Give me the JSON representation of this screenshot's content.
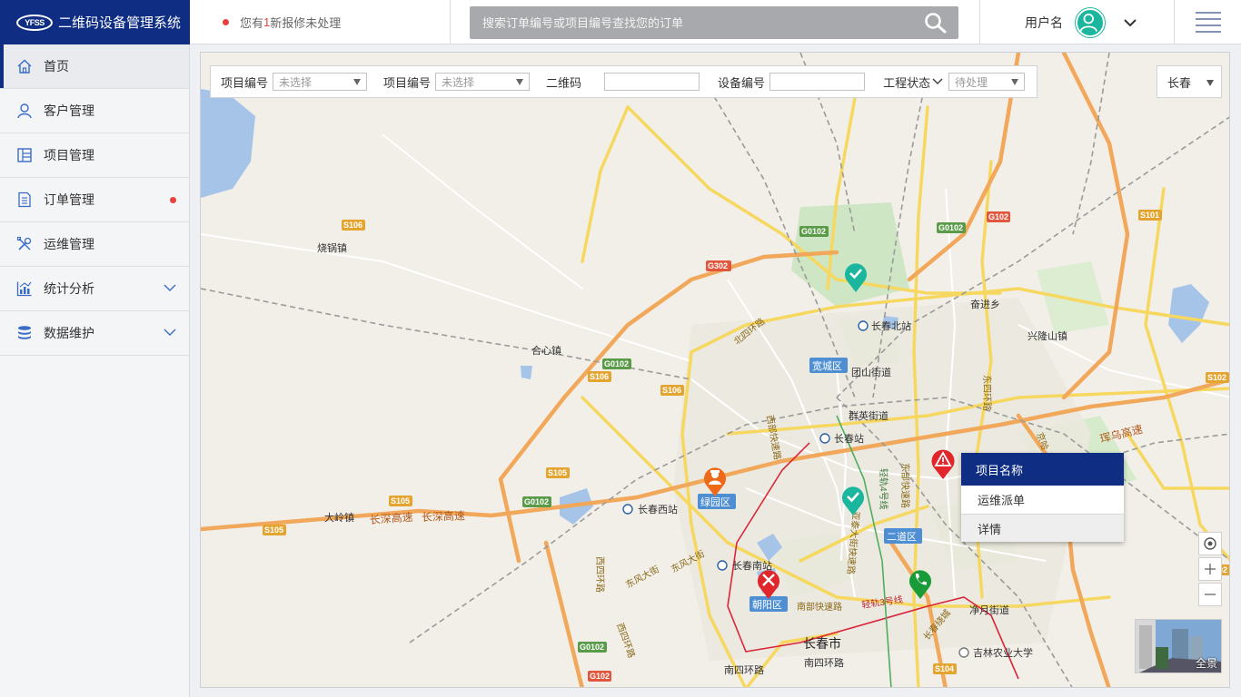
{
  "header": {
    "logo_text": "YFSS",
    "title": "二维码设备管理系统",
    "notice_prefix": "您有",
    "notice_count": "1",
    "notice_suffix": "新报修未处理",
    "search_placeholder": "搜索订单编号或项目编号查找您的订单",
    "username": "用户名"
  },
  "sidebar": {
    "items": [
      {
        "label": "首页",
        "icon": "home-icon",
        "active": true
      },
      {
        "label": "客户管理",
        "icon": "user-icon"
      },
      {
        "label": "项目管理",
        "icon": "project-icon"
      },
      {
        "label": "订单管理",
        "icon": "order-icon",
        "badge": true
      },
      {
        "label": "运维管理",
        "icon": "tools-icon"
      },
      {
        "label": "统计分析",
        "icon": "chart-icon",
        "expandable": true
      },
      {
        "label": "数据维护",
        "icon": "database-icon",
        "expandable": true
      }
    ]
  },
  "filters": {
    "project_no_1_label": "项目编号",
    "project_no_1_value": "未选择",
    "project_no_2_label": "项目编号",
    "project_no_2_value": "未选择",
    "qrcode_label": "二维码",
    "device_no_label": "设备编号",
    "status_label": "工程状态",
    "status_value": "待处理",
    "city_value": "长春"
  },
  "context_menu": {
    "title": "项目名称",
    "items": [
      "运维派单",
      "详情"
    ]
  },
  "map": {
    "panorama_label": "全景",
    "labels": {
      "l1": "烧锅镇",
      "l2": "合心镇",
      "l3": "大岭镇",
      "l4": "长深高速",
      "l5": "长深高速",
      "l6": "长春北站",
      "l7": "团山街道",
      "l8": "群英街道",
      "l9": "长春站",
      "l10": "长春西站",
      "l11": "长春南站",
      "l12": "奋进乡",
      "l13": "兴隆山镇",
      "l14": "珲乌高速",
      "l15": "净月街道",
      "l16": "吉林农业大学",
      "l17": "长春市",
      "l18": "南四环路",
      "l19": "南四环路",
      "l20": "东四环路",
      "l21": "西四环路",
      "l22": "东风大街",
      "l23": "东风大街",
      "l24": "北四环路",
      "l25": "南部快速路",
      "l26": "轻轨3号线",
      "l27": "西部快速路",
      "l28": "东部快速路",
      "l29": "亚泰大街快速路",
      "l30": "京哈",
      "l31": "长春绕城",
      "l32": "轻轨4号线",
      "l33": "西四环路"
    },
    "districts": {
      "d1": "宽城区",
      "d2": "绿园区",
      "d3": "二道区",
      "d4": "朝阳区"
    },
    "shields": {
      "s1": "S106",
      "s2": "S106",
      "s3": "S106",
      "s4": "G0102",
      "s5": "G302",
      "s6": "G0102",
      "s7": "G102",
      "s8": "S101",
      "s9": "G0102",
      "s10": "S105",
      "s11": "S105",
      "s12": "S105",
      "s13": "G0102",
      "s14": "S102",
      "s15": "G0102",
      "s16": "G102",
      "s17": "S104",
      "s18": "S102"
    }
  },
  "colors": {
    "brand": "#0f2d82",
    "alert": "#e94040",
    "marker_ok": "#1ab69d",
    "marker_warn": "#e0262b",
    "marker_worker": "#ec6a1a",
    "marker_phone": "#1a9b3a"
  }
}
